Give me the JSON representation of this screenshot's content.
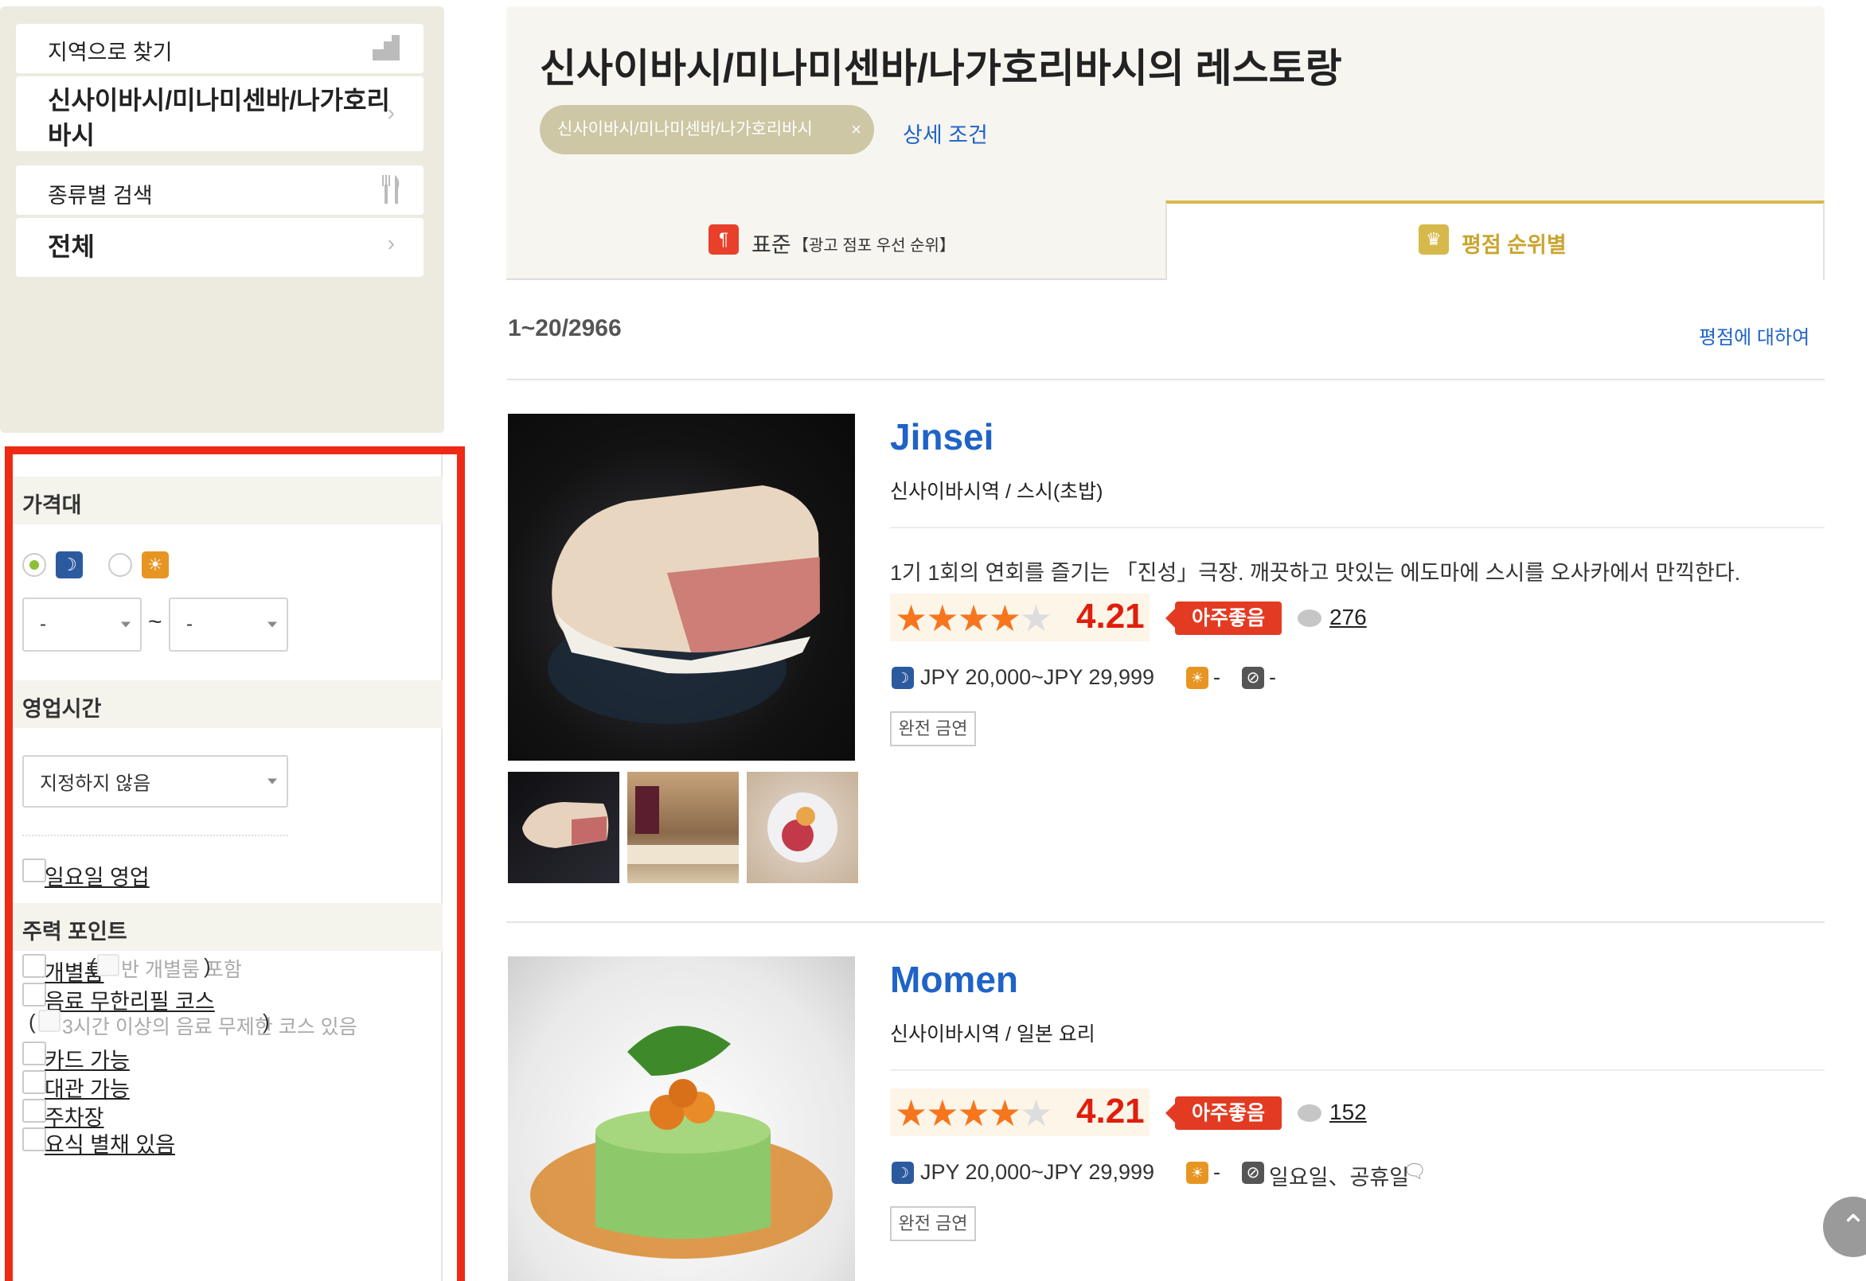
{
  "sidebar": {
    "area_search_label": "지역으로 찾기",
    "area_name": "신사이바시/미나미센바/나가호리바시",
    "genre_search_label": "종류별 검색",
    "genre_value": "전체"
  },
  "filters": {
    "price_title": "가격대",
    "price_min": "-",
    "price_max": "-",
    "range_sep": "~",
    "hours_title": "영업시간",
    "hours_value": "지정하지 않음",
    "sunday_open": "일요일 영업",
    "features_title": "주력 포인트",
    "private_room": "개별룸",
    "semi_private": "반 개별룸 포함",
    "all_you_drink": "음료 무한리필 코스",
    "three_hours": "3시간 이상의 음료 무제한 코스 있음",
    "card_ok": "카드 가능",
    "rental_ok": "대관 가능",
    "parking": "주차장",
    "partial_item": "요식 별채 있음",
    "paren_open": "(",
    "paren_close": ")"
  },
  "header": {
    "title": "신사이바시/미나미센바/나가호리바시의 레스토랑",
    "chip_label": "신사이바시/미나미센바/나가호리바시",
    "chip_close": "×",
    "detail_link": "상세 조건",
    "tab_standard": "표준",
    "tab_standard_note": "【광고 점포 우선 순위】",
    "tab_rank": "평점 순위별"
  },
  "results": {
    "count": "1~20/2966",
    "about_rating": "평점에 대하여"
  },
  "restaurants": [
    {
      "name": "Jinsei",
      "genre": "신사이바시역 / 스시(초밥)",
      "description": "1기 1회의 연회를 즐기는 「진성」극장. 깨끗하고 맛있는 에도마에 스시를 오사카에서 만끽한다.",
      "stars": "★★★★",
      "star_off": "★",
      "score": "4.21",
      "badge": "아주좋음",
      "reviews": "276",
      "dinner_price": "JPY 20,000~JPY 29,999",
      "lunch_price": "-",
      "closed": "-",
      "tag": "완전 금연"
    },
    {
      "name": "Momen",
      "genre": "신사이바시역 / 일본 요리",
      "stars": "★★★★",
      "star_off": "★",
      "score": "4.21",
      "badge": "아주좋음",
      "reviews": "152",
      "dinner_price": "JPY 20,000~JPY 29,999",
      "lunch_price": "-",
      "closed": "일요일、공휴일",
      "tag": "완전 금연"
    }
  ],
  "colors": {
    "accent_red": "#ee2a14",
    "link_blue": "#1f63c7",
    "star_orange": "#f7751d",
    "score_red": "#e01e0b",
    "gold": "#d7b84b"
  },
  "icons": [
    "building-icon",
    "fork-knife-icon",
    "chevron-right-icon",
    "moon-icon",
    "sun-icon",
    "crown-icon",
    "speech-bubble-icon",
    "no-entry-icon",
    "arrow-up-icon"
  ]
}
